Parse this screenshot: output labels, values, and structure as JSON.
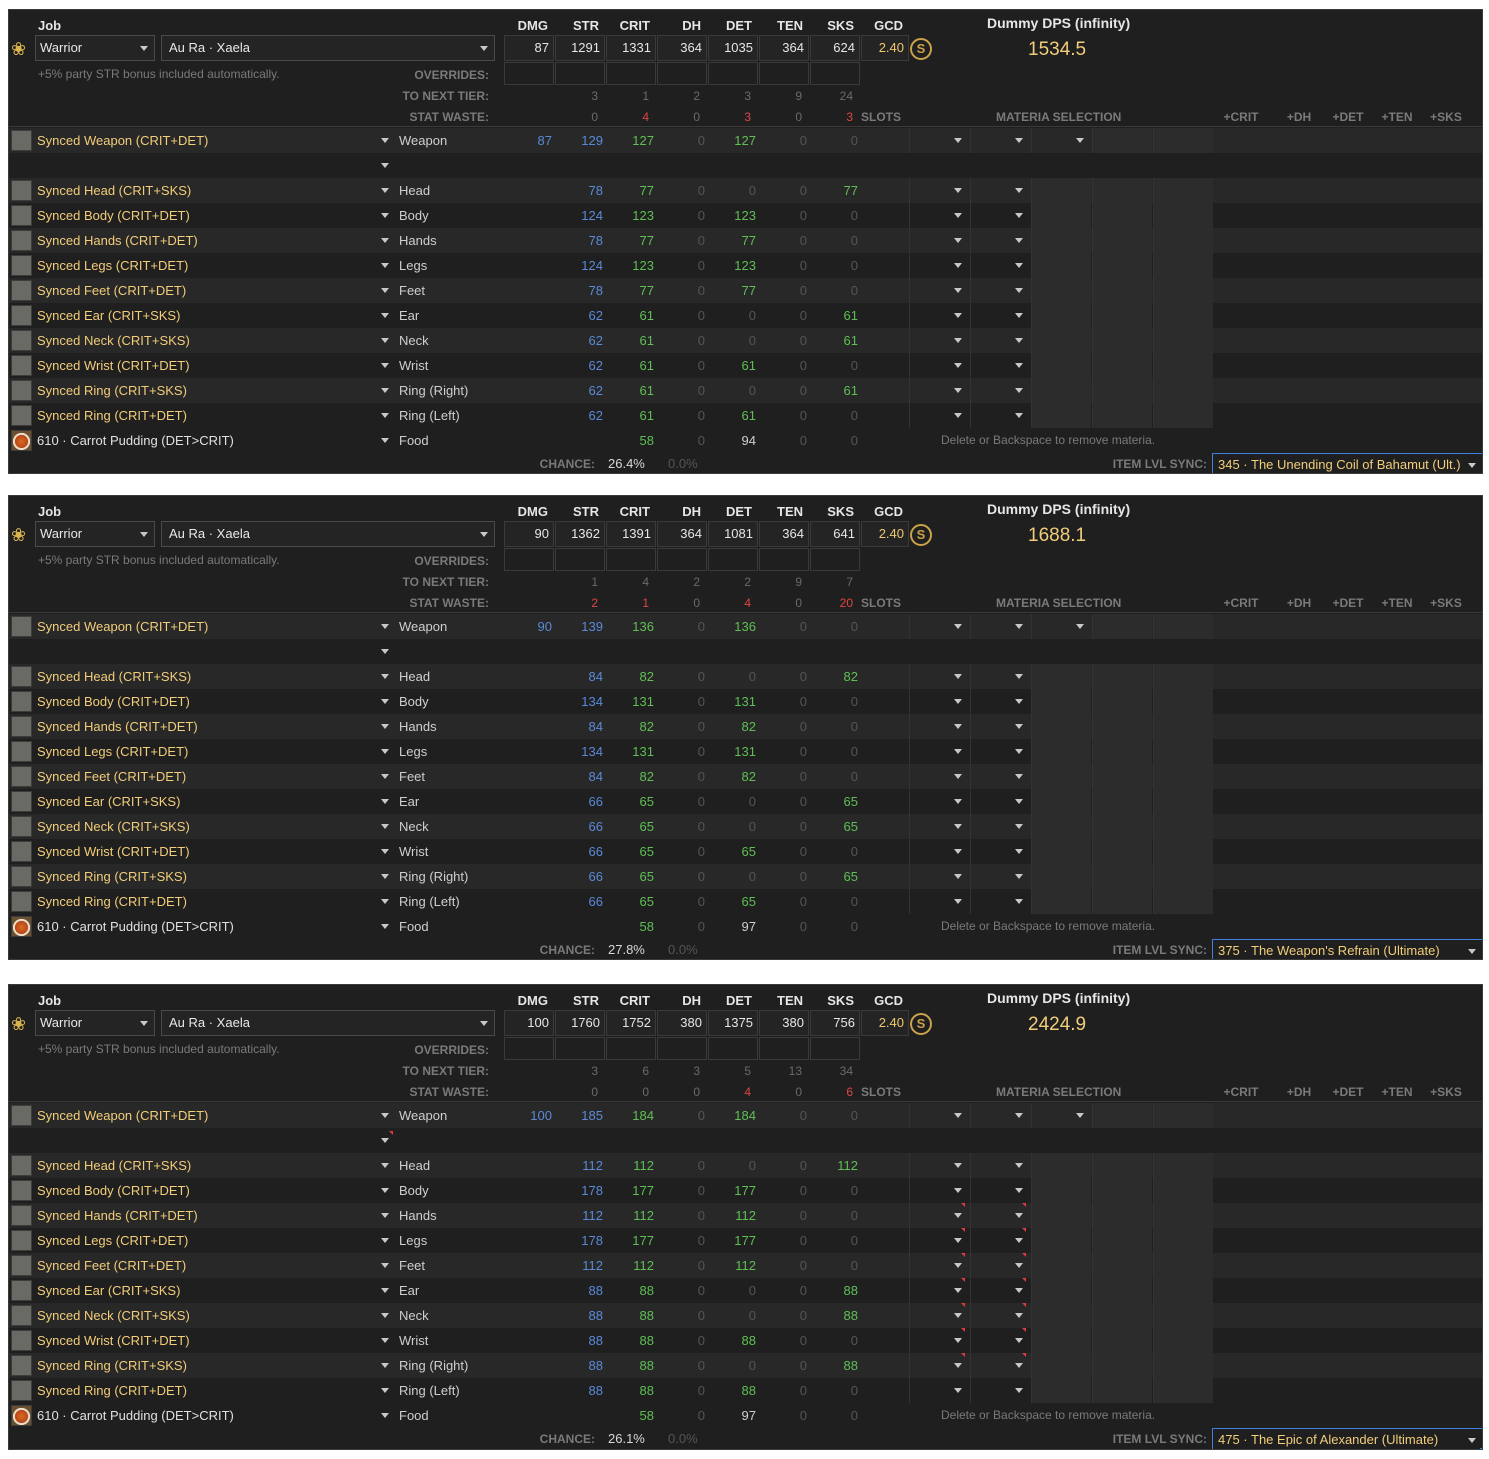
{
  "shared": {
    "job_label": "Job",
    "job": "Warrior",
    "race": "Au Ra · Xaela",
    "party_bonus_note": "+5% party STR bonus included automatically.",
    "overrides_label": "OVERRIDES:",
    "next_tier_label": "TO NEXT TIER:",
    "stat_waste_label": "STAT WASTE:",
    "slots_label": "SLOTS",
    "materia_selection_label": "MATERIA SELECTION",
    "materia_cols": [
      "+CRIT",
      "+DH",
      "+DET",
      "+TEN",
      "+SKS"
    ],
    "stat_cols": [
      "DMG",
      "STR",
      "CRIT",
      "DH",
      "DET",
      "TEN",
      "SKS",
      "GCD"
    ],
    "dps_label": "Dummy DPS (infinity)",
    "chance_label": "CHANCE:",
    "chance_zero": "0.0%",
    "sync_label": "ITEM LVL SYNC:",
    "delete_hint": "Delete or Backspace to remove materia.",
    "gear_names": [
      "Synced Weapon (CRIT+DET)",
      "Synced Head (CRIT+SKS)",
      "Synced Body (CRIT+DET)",
      "Synced Hands (CRIT+DET)",
      "Synced Legs (CRIT+DET)",
      "Synced Feet (CRIT+DET)",
      "Synced Ear (CRIT+SKS)",
      "Synced Neck (CRIT+SKS)",
      "Synced Wrist (CRIT+DET)",
      "Synced Ring (CRIT+SKS)",
      "Synced Ring (CRIT+DET)"
    ],
    "slot_names": [
      "Weapon",
      "Head",
      "Body",
      "Hands",
      "Legs",
      "Feet",
      "Ear",
      "Neck",
      "Wrist",
      "Ring (Right)",
      "Ring (Left)"
    ],
    "food_name": "610 · Carrot Pudding (DET>CRIT)",
    "food_slot": "Food",
    "colors": {
      "gold": "#f2cd7a",
      "blue": "#5a8ad8",
      "green": "#5fbf55",
      "red": "#e04545",
      "accent": "#3f7fe0"
    }
  },
  "panels": [
    {
      "stats": [
        "87",
        "1291",
        "1331",
        "364",
        "1035",
        "364",
        "624",
        "2.40"
      ],
      "dps": "1534.5",
      "next_tier": [
        "3",
        "1",
        "2",
        "3",
        "9",
        "24"
      ],
      "waste": [
        "0",
        "4",
        "0",
        "3",
        "0",
        "3"
      ],
      "weapon_dmg": "87",
      "rows": [
        [
          "129",
          "127",
          "0",
          "127",
          "0",
          "0"
        ],
        [
          "78",
          "77",
          "0",
          "0",
          "0",
          "77"
        ],
        [
          "124",
          "123",
          "0",
          "123",
          "0",
          "0"
        ],
        [
          "78",
          "77",
          "0",
          "77",
          "0",
          "0"
        ],
        [
          "124",
          "123",
          "0",
          "123",
          "0",
          "0"
        ],
        [
          "78",
          "77",
          "0",
          "77",
          "0",
          "0"
        ],
        [
          "62",
          "61",
          "0",
          "0",
          "0",
          "61"
        ],
        [
          "62",
          "61",
          "0",
          "0",
          "0",
          "61"
        ],
        [
          "62",
          "61",
          "0",
          "61",
          "0",
          "0"
        ],
        [
          "62",
          "61",
          "0",
          "0",
          "0",
          "61"
        ],
        [
          "62",
          "61",
          "0",
          "61",
          "0",
          "0"
        ]
      ],
      "food": [
        "58",
        "0",
        "94",
        "0",
        "0"
      ],
      "chance": "26.4%",
      "sync": "345 · The Unending Coil of Bahamut (Ult.)"
    },
    {
      "stats": [
        "90",
        "1362",
        "1391",
        "364",
        "1081",
        "364",
        "641",
        "2.40"
      ],
      "dps": "1688.1",
      "next_tier": [
        "1",
        "4",
        "2",
        "2",
        "9",
        "7"
      ],
      "waste": [
        "2",
        "1",
        "0",
        "4",
        "0",
        "20"
      ],
      "weapon_dmg": "90",
      "rows": [
        [
          "139",
          "136",
          "0",
          "136",
          "0",
          "0"
        ],
        [
          "84",
          "82",
          "0",
          "0",
          "0",
          "82"
        ],
        [
          "134",
          "131",
          "0",
          "131",
          "0",
          "0"
        ],
        [
          "84",
          "82",
          "0",
          "82",
          "0",
          "0"
        ],
        [
          "134",
          "131",
          "0",
          "131",
          "0",
          "0"
        ],
        [
          "84",
          "82",
          "0",
          "82",
          "0",
          "0"
        ],
        [
          "66",
          "65",
          "0",
          "0",
          "0",
          "65"
        ],
        [
          "66",
          "65",
          "0",
          "0",
          "0",
          "65"
        ],
        [
          "66",
          "65",
          "0",
          "65",
          "0",
          "0"
        ],
        [
          "66",
          "65",
          "0",
          "0",
          "0",
          "65"
        ],
        [
          "66",
          "65",
          "0",
          "65",
          "0",
          "0"
        ]
      ],
      "food": [
        "58",
        "0",
        "97",
        "0",
        "0"
      ],
      "chance": "27.8%",
      "sync": "375 · The Weapon's Refrain (Ultimate)"
    },
    {
      "stats": [
        "100",
        "1760",
        "1752",
        "380",
        "1375",
        "380",
        "756",
        "2.40"
      ],
      "dps": "2424.9",
      "next_tier": [
        "3",
        "6",
        "3",
        "5",
        "13",
        "34"
      ],
      "waste": [
        "0",
        "0",
        "0",
        "4",
        "0",
        "6"
      ],
      "weapon_dmg": "100",
      "rows": [
        [
          "185",
          "184",
          "0",
          "184",
          "0",
          "0"
        ],
        [
          "112",
          "112",
          "0",
          "0",
          "0",
          "112"
        ],
        [
          "178",
          "177",
          "0",
          "177",
          "0",
          "0"
        ],
        [
          "112",
          "112",
          "0",
          "112",
          "0",
          "0"
        ],
        [
          "178",
          "177",
          "0",
          "177",
          "0",
          "0"
        ],
        [
          "112",
          "112",
          "0",
          "112",
          "0",
          "0"
        ],
        [
          "88",
          "88",
          "0",
          "0",
          "0",
          "88"
        ],
        [
          "88",
          "88",
          "0",
          "0",
          "0",
          "88"
        ],
        [
          "88",
          "88",
          "0",
          "88",
          "0",
          "0"
        ],
        [
          "88",
          "88",
          "0",
          "0",
          "0",
          "88"
        ],
        [
          "88",
          "88",
          "0",
          "88",
          "0",
          "0"
        ]
      ],
      "food": [
        "58",
        "0",
        "97",
        "0",
        "0"
      ],
      "chance": "26.1%",
      "sync": "475 · The Epic of Alexander (Ultimate)"
    }
  ]
}
